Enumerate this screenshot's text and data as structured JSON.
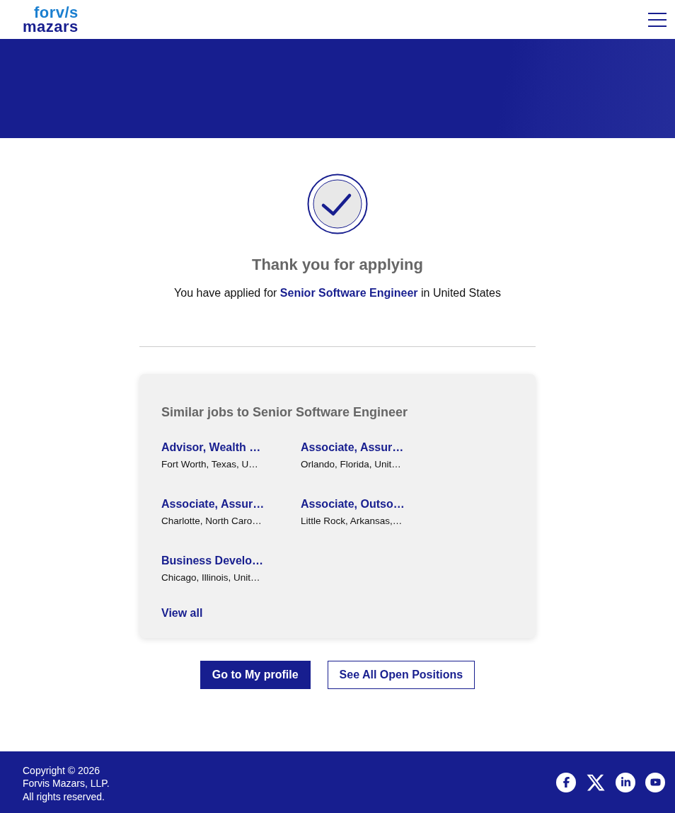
{
  "header": {
    "logo_top": "forv/s",
    "logo_bottom": "mazars"
  },
  "confirmation": {
    "title": "Thank you for applying",
    "message": "You have applied for **Senior Software Engineer** in United States"
  },
  "similar_jobs": {
    "title": "Similar jobs to Senior Software Engineer",
    "jobs": [
      {
        "title": "Advisor, Wealth …",
        "location": "Fort Worth, Texas, U…"
      },
      {
        "title": "Associate, Assur…",
        "location": "Orlando, Florida, Unit…"
      },
      {
        "title": "Associate, Assur…",
        "location": "Charlotte, North Caro…"
      },
      {
        "title": "Associate, Outso…",
        "location": "Little Rock, Arkansas,…"
      },
      {
        "title": "Business Develo…",
        "location": "Chicago, Illinois, Unit…"
      }
    ],
    "view_all": "View all"
  },
  "buttons": [
    {
      "label": "Go to My profile",
      "kind": "primary"
    },
    {
      "label": "See All Open Positions",
      "kind": "secondary"
    }
  ],
  "footer": {
    "lines": [
      "Copyright © 2026",
      "Forvis Mazars, LLP.",
      "All rights reserved."
    ],
    "social": [
      {
        "kind": "facebook"
      },
      {
        "kind": "x"
      },
      {
        "kind": "linkedin"
      },
      {
        "kind": "youtube"
      }
    ]
  }
}
